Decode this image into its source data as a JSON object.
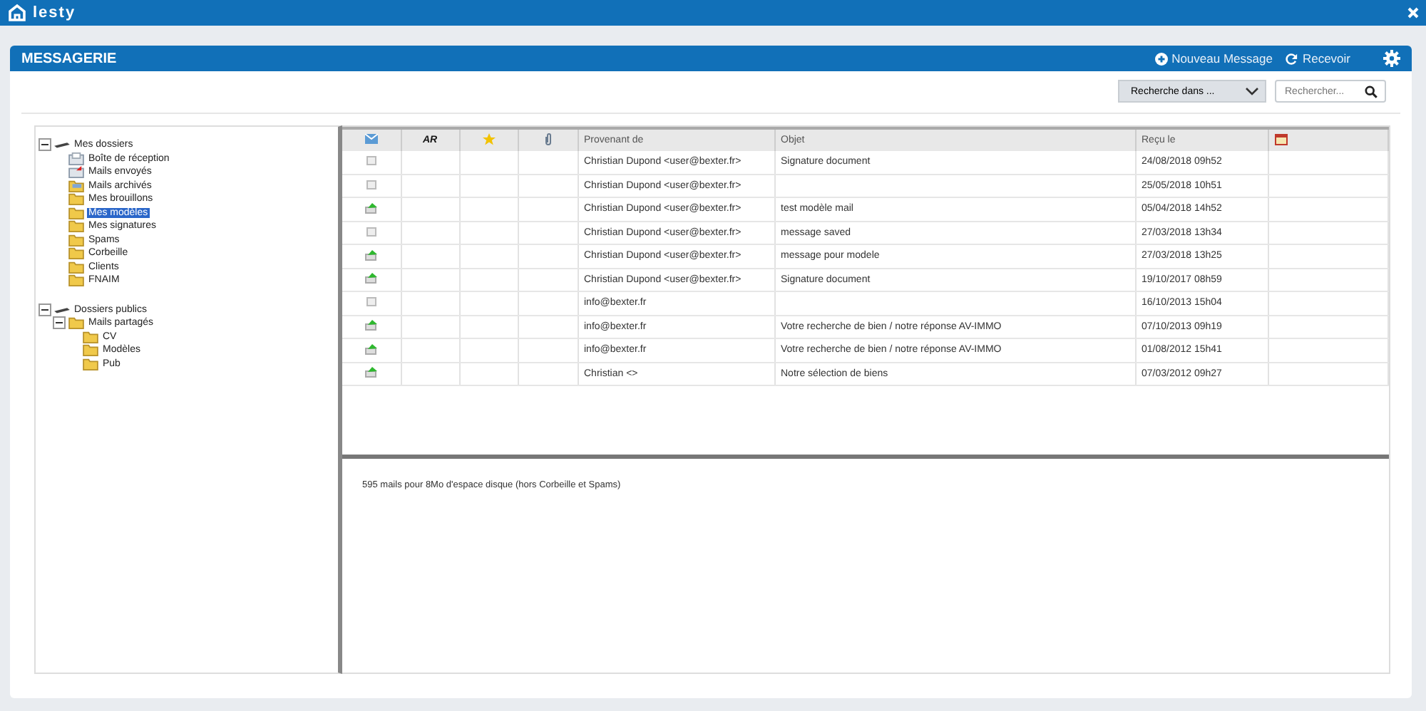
{
  "app": {
    "title": "lesty"
  },
  "module": {
    "title": "MESSAGERIE",
    "actions": [
      {
        "kind": "new",
        "label": "Nouveau Message"
      },
      {
        "kind": "refresh",
        "label": "Recevoir"
      }
    ]
  },
  "search": {
    "scope": "Recherche dans ...",
    "placeholder": "Rechercher..."
  },
  "tree": [
    {
      "label": "Mes dossiers",
      "expanded": true,
      "children": [
        {
          "label": "Boîte de réception",
          "kind": "inbox",
          "selected": false
        },
        {
          "label": "Mails envoyés",
          "kind": "sent",
          "selected": false
        },
        {
          "label": "Mails archivés",
          "kind": "archive",
          "selected": false
        },
        {
          "label": "Mes brouillons",
          "kind": "folder",
          "selected": false
        },
        {
          "label": "Mes modèles",
          "kind": "folder",
          "selected": true
        },
        {
          "label": "Mes signatures",
          "kind": "folder",
          "selected": false
        },
        {
          "label": "Spams",
          "kind": "folder",
          "selected": false
        },
        {
          "label": "Corbeille",
          "kind": "folder",
          "selected": false
        },
        {
          "label": "Clients",
          "kind": "folder",
          "selected": false
        },
        {
          "label": "FNAIM",
          "kind": "folder",
          "selected": false
        }
      ]
    },
    {
      "label": "Dossiers publics",
      "expanded": true,
      "children": [
        {
          "label": "Mails partagés",
          "kind": "folder",
          "selected": false,
          "expanded": true,
          "children": [
            {
              "label": "CV",
              "kind": "folder",
              "selected": false
            },
            {
              "label": "Modèles",
              "kind": "folder",
              "selected": false
            },
            {
              "label": "Pub",
              "kind": "folder",
              "selected": false
            }
          ]
        }
      ]
    }
  ],
  "table": {
    "columns": [
      "AR",
      "Provenant de",
      "Objet",
      "Reçu le"
    ],
    "rows": [
      {
        "kind": "read",
        "from": "Christian Dupond <user@bexter.fr>",
        "subject": "Signature document",
        "received": "24/08/2018 09h52"
      },
      {
        "kind": "read",
        "from": "Christian Dupond <user@bexter.fr>",
        "subject": "",
        "received": "25/05/2018 10h51"
      },
      {
        "kind": "sent",
        "from": "Christian Dupond <user@bexter.fr>",
        "subject": "test modèle mail",
        "received": "05/04/2018 14h52"
      },
      {
        "kind": "read",
        "from": "Christian Dupond <user@bexter.fr>",
        "subject": "message saved",
        "received": "27/03/2018 13h34"
      },
      {
        "kind": "sent",
        "from": "Christian Dupond <user@bexter.fr>",
        "subject": "message pour modele",
        "received": "27/03/2018 13h25"
      },
      {
        "kind": "sent",
        "from": "Christian Dupond <user@bexter.fr>",
        "subject": "Signature document",
        "received": "19/10/2017 08h59"
      },
      {
        "kind": "read",
        "from": "info@bexter.fr",
        "subject": "",
        "received": "16/10/2013 15h04"
      },
      {
        "kind": "sent",
        "from": "info@bexter.fr",
        "subject": "Votre recherche de bien / notre réponse AV-IMMO",
        "received": "07/10/2013 09h19"
      },
      {
        "kind": "sent",
        "from": "info@bexter.fr",
        "subject": "Votre recherche de bien / notre réponse AV-IMMO",
        "received": "01/08/2012 15h41"
      },
      {
        "kind": "sent",
        "from": "Christian <>",
        "subject": "Notre sélection de biens",
        "received": "07/03/2012 09h27"
      }
    ]
  },
  "footer": {
    "text": "595 mails pour 8Mo d'espace disque (hors Corbeille et Spams)"
  }
}
